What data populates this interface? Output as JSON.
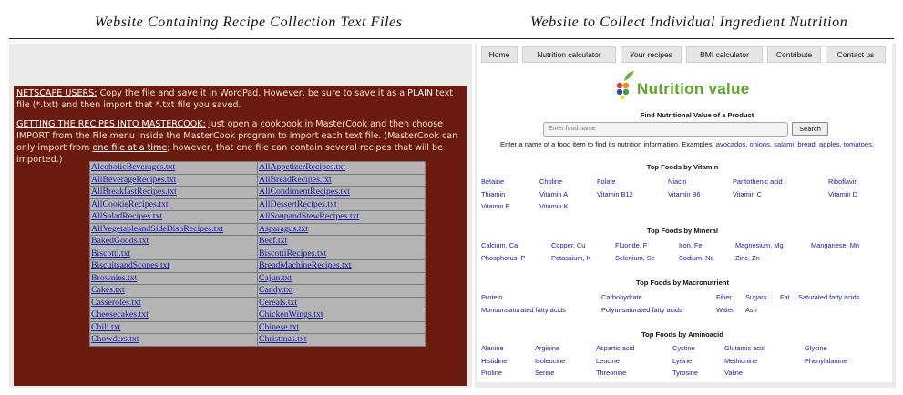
{
  "captions": {
    "left": "Website Containing Recipe Collection Text Files",
    "right": "Website to Collect Individual Ingredient Nutrition"
  },
  "left_site": {
    "p1_head": "NETSCAPE USERS:",
    "p1_text_a": " Copy the file and save it in WordPad. However, be sure to save it as a ",
    "p1_plain": "PLAIN",
    "p1_text_b": " text file (*.txt) and then import that *.txt file you saved.",
    "p2_head": "GETTING THE RECIPES INTO MASTERCOOK:",
    "p2_text_a": " Just open a cookbook in MasterCook and then choose IMPORT from the File menu inside the MasterCook program to import each text file. (MasterCook can only import from ",
    "p2_link": "one file at a time",
    "p2_text_b": "; however, that one file can contain several recipes that will be imported.)",
    "files": [
      [
        "AlcoholicBeverages.txt",
        "AllAppetizerRecipes.txt"
      ],
      [
        "AllBeverageRecipes.txt",
        "AllBreadRecipes.txt"
      ],
      [
        "AllBreakfastRecipes.txt",
        "AllCondimentRecipes.txt"
      ],
      [
        "AllCookieRecipes.txt",
        "AllDessertRecipes.txt"
      ],
      [
        "AllSaladRecipes.txt",
        "AllSoupandStewRecipes.txt"
      ],
      [
        "AllVegetableandSideDishRecipes.txt",
        "Asparagus.txt"
      ],
      [
        "BakedGoods.txt",
        "Beef.txt"
      ],
      [
        "Biscotti.txt",
        "BiscottiRecipes.txt"
      ],
      [
        "BiscuitsandScones.txt",
        "BreadMachineRecipes.txt"
      ],
      [
        "Brownies.txt",
        "Cajun.txt"
      ],
      [
        "Cakes.txt",
        "Candy.txt"
      ],
      [
        "Casseroles.txt",
        "Cereals.txt"
      ],
      [
        "Cheesecakes.txt",
        "ChickenWings.txt"
      ],
      [
        "Chili.txt",
        "Chinese.txt"
      ],
      [
        "Chowders.txt",
        "Christmas.txt"
      ]
    ]
  },
  "right_site": {
    "nav": [
      "Home",
      "Nutrition calculator",
      "Your recipes",
      "BMI calculator",
      "Contribute",
      "Contact us"
    ],
    "logo_text": "Nutrition value",
    "search_title": "Find Nutritional Value of a Product",
    "search_placeholder": "Enter food name",
    "search_button": "Search",
    "hint_text": "Enter a name of a food item to find its nutrition information. Examples: ",
    "hint_examples": [
      "avocados",
      "onions",
      "salami",
      "bread",
      "apples",
      "tomatoes"
    ],
    "sections": {
      "vitamin": {
        "title": "Top Foods by Vitamin",
        "items": [
          "Betaine",
          "Choline",
          "Folate",
          "Niacin",
          "Pantothenic acid",
          "Riboflavin",
          "Thiamin",
          "Vitamin A",
          "Vitamin B12",
          "Vitamin B6",
          "Vitamin C",
          "Vitamin D",
          "Vitamin E",
          "Vitamin K"
        ]
      },
      "mineral": {
        "title": "Top Foods by Mineral",
        "items": [
          "Calcium, Ca",
          "Copper, Cu",
          "Fluoride, F",
          "Iron, Fe",
          "Magnesium, Mg",
          "Manganese, Mn",
          "Phosphorus, P",
          "Potassium, K",
          "Selenium, Se",
          "Sodium, Na",
          "Zinc, Zn"
        ]
      },
      "macro": {
        "title": "Top Foods by Macronutrient",
        "items": [
          "Protein",
          "Carbohydrate",
          "Fiber",
          "Sugars",
          "Fat",
          "Saturated fatty acids",
          "Monounsaturated fatty acids",
          "Polyunsaturated fatty acids",
          "Water",
          "Ash"
        ]
      },
      "amino": {
        "title": "Top Foods by Aminoacid",
        "items": [
          "Alanine",
          "Arginine",
          "Aspartic acid",
          "Cystine",
          "Glutamic acid",
          "Glycine",
          "Histidine",
          "Isoleucine",
          "Leucine",
          "Lysine",
          "Methionine",
          "Phenylalanine",
          "Proline",
          "Serine",
          "Threonine",
          "Tyrosine",
          "Valine"
        ]
      }
    }
  }
}
